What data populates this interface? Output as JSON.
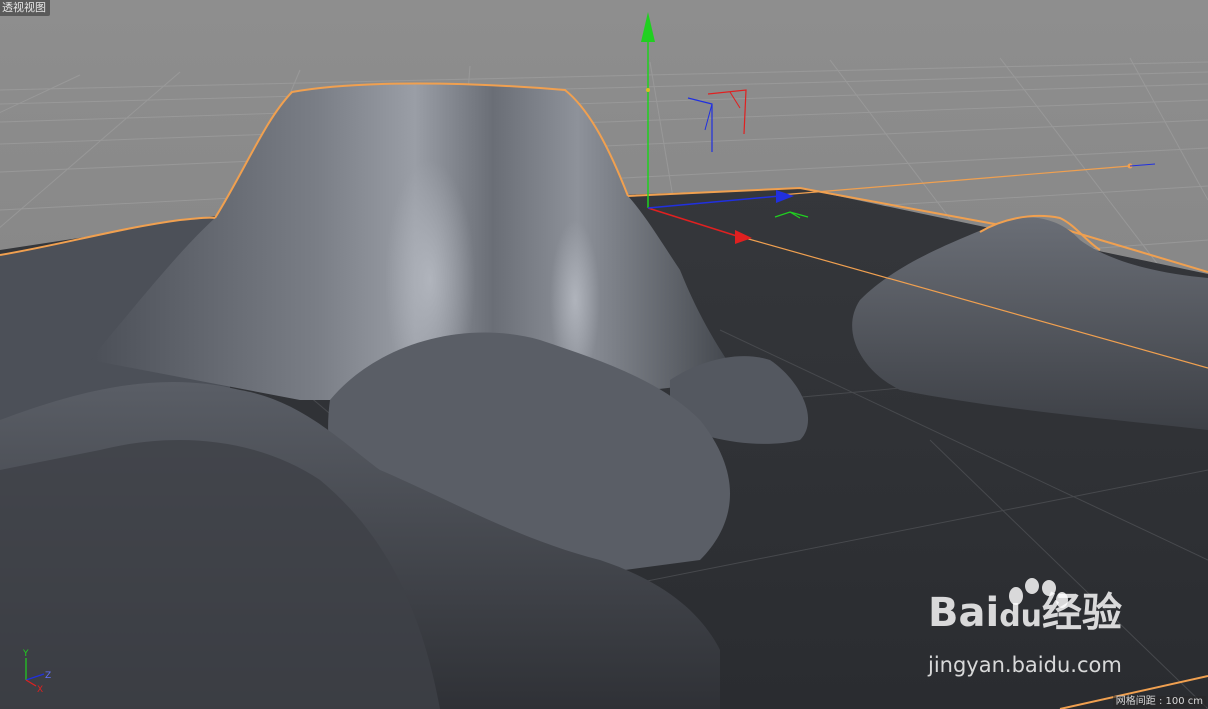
{
  "viewport": {
    "view_name": "透视视图",
    "grid_spacing_label": "网格间距 : 100 cm",
    "background_color": "#8a8a8a",
    "floor_color": "#2e3034",
    "terrain_color": "#5c6068",
    "selection_outline_color": "#f0a050"
  },
  "gizmo": {
    "x_color": "#e02020",
    "y_color": "#20d020",
    "z_color": "#2030e0"
  },
  "mini_axis": {
    "y_label": "Y",
    "z_label": "Z",
    "x_label": "X"
  },
  "watermark": {
    "logo_text_left": "Bai",
    "logo_text_du": "du",
    "logo_text_right": "经验",
    "url": "jingyan.baidu.com"
  }
}
